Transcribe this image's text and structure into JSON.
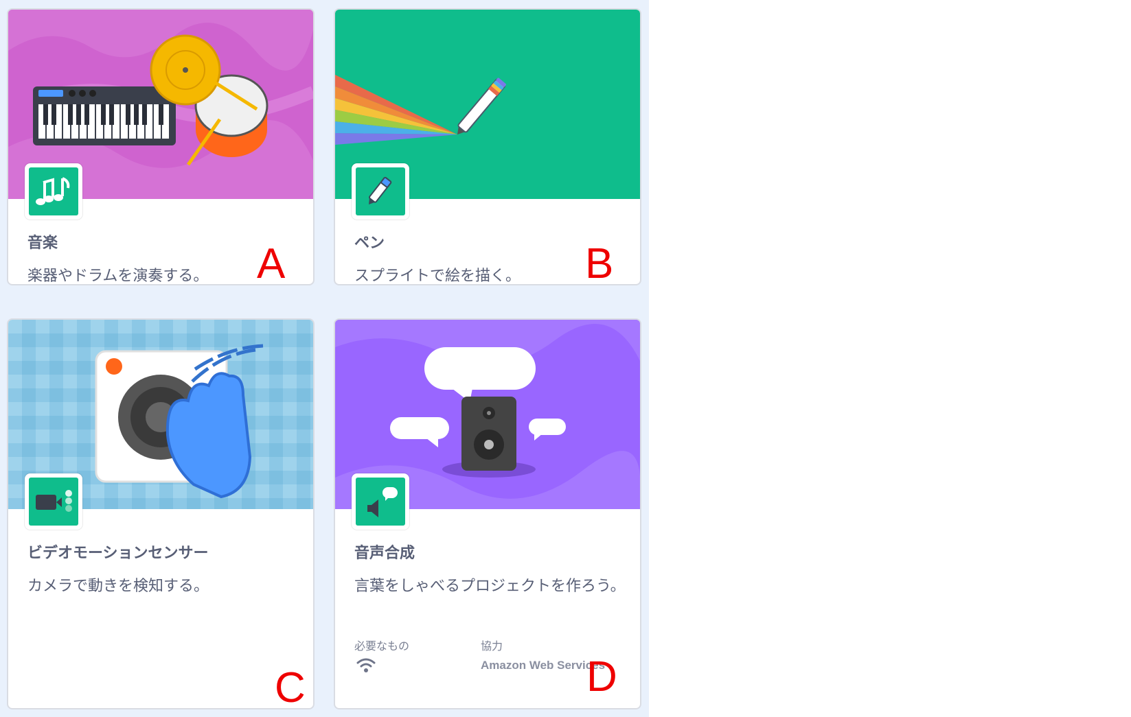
{
  "cards": [
    {
      "title": "音楽",
      "description": "楽器やドラムを演奏する。",
      "letter": "A",
      "icon": "music-notes-icon",
      "hero_color": "#cf63cf"
    },
    {
      "title": "ペン",
      "description": "スプライトで絵を描く。",
      "letter": "B",
      "icon": "pen-icon",
      "hero_color": "#0fbd8c"
    },
    {
      "title": "ビデオモーションセンサー",
      "description": "カメラで動きを検知する。",
      "letter": "C",
      "icon": "video-camera-icon",
      "hero_color": "#8cc8e6"
    },
    {
      "title": "音声合成",
      "description": "言葉をしゃべるプロジェクトを作ろう。",
      "letter": "D",
      "icon": "speech-icon",
      "hero_color": "#9966ff",
      "requires_label": "必要なもの",
      "requires_icon": "wifi-icon",
      "collaboration_label": "協力",
      "collaborator": "Amazon Web Services"
    }
  ],
  "colors": {
    "background": "#e9f1fc",
    "extension_green": "#0fbd8c",
    "text": "#575e75",
    "annotation_red": "#ee0000"
  }
}
